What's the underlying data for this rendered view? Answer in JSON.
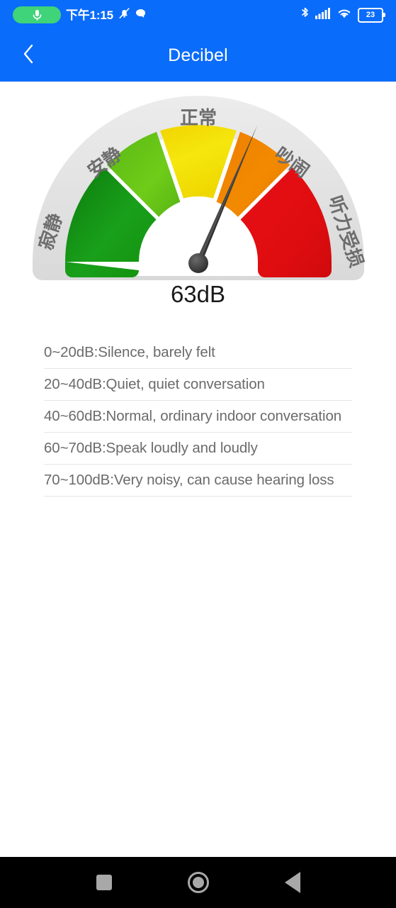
{
  "status_bar": {
    "mic_icon": "microphone-icon",
    "time": "下午1:15",
    "mute_icon": "bell-muted-icon",
    "message_icon": "chat-bubble-icon",
    "bluetooth_icon": "bluetooth-icon",
    "signal_icon": "cellular-signal-icon",
    "wifi_icon": "wifi-icon",
    "battery_level": "23",
    "colors": {
      "bar_background": "#0a6cfa",
      "mic_pill": "#3fd37a",
      "icon": "#ffffff"
    }
  },
  "app_bar": {
    "back_icon": "chevron-left-icon",
    "title": "Decibel",
    "background": "#0a6cfa"
  },
  "chart_data": {
    "type": "gauge",
    "title": "Decibel",
    "value": 63,
    "unit": "dB",
    "value_label": "63dB",
    "min": 0,
    "max": 100,
    "needle_color": "#3a3a3a",
    "outer_ring_color": "#e3e3e3",
    "segments": [
      {
        "label": "寂静",
        "label_en": "Silence",
        "range": [
          0,
          20
        ],
        "color": "#19a01a",
        "start_angle": -90,
        "end_angle": -54
      },
      {
        "label": "安静",
        "label_en": "Quiet",
        "range": [
          20,
          40
        ],
        "color": "#6fcc18",
        "start_angle": -54,
        "end_angle": -18
      },
      {
        "label": "正常",
        "label_en": "Normal",
        "range": [
          40,
          60
        ],
        "color": "#f5e70e",
        "start_angle": -18,
        "end_angle": 18
      },
      {
        "label": "吵闹",
        "label_en": "Noisy",
        "range": [
          60,
          80
        ],
        "color": "#f28a00",
        "start_angle": 18,
        "end_angle": 54
      },
      {
        "label": "听力受损",
        "label_en": "Hearing damage",
        "range": [
          80,
          100
        ],
        "color": "#e00d10",
        "start_angle": 54,
        "end_angle": 90
      }
    ]
  },
  "db_scale_list": [
    "0~20dB:Silence, barely felt",
    "20~40dB:Quiet, quiet conversation",
    "40~60dB:Normal, ordinary indoor conversation",
    "60~70dB:Speak loudly and loudly",
    "70~100dB:Very noisy, can cause hearing loss"
  ],
  "nav_bar": {
    "recents_icon": "square-icon",
    "home_icon": "circle-icon",
    "back_icon": "triangle-left-icon",
    "background": "#000000"
  }
}
